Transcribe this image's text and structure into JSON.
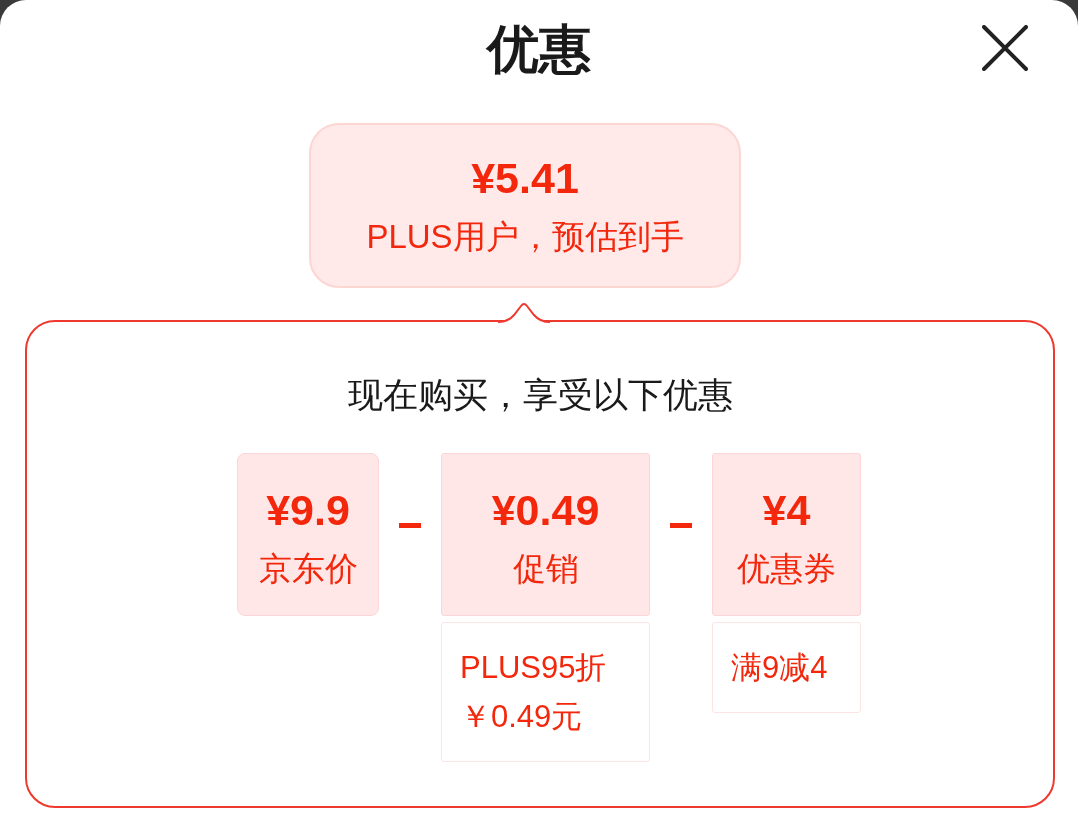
{
  "sheet": {
    "title": "优惠"
  },
  "estimate": {
    "price": "¥5.41",
    "caption": "PLUS用户，预估到手"
  },
  "breakdown": {
    "heading": "现在购买，享受以下优惠",
    "items": [
      {
        "kind": "base",
        "price": "¥9.9",
        "label": "京东价"
      },
      {
        "kind": "deduction",
        "price": "¥0.49",
        "label": "促销",
        "details": [
          "PLUS95折",
          "￥0.49元"
        ]
      },
      {
        "kind": "deduction",
        "price": "¥4",
        "label": "优惠券",
        "details": [
          "满9减4"
        ]
      }
    ]
  }
}
